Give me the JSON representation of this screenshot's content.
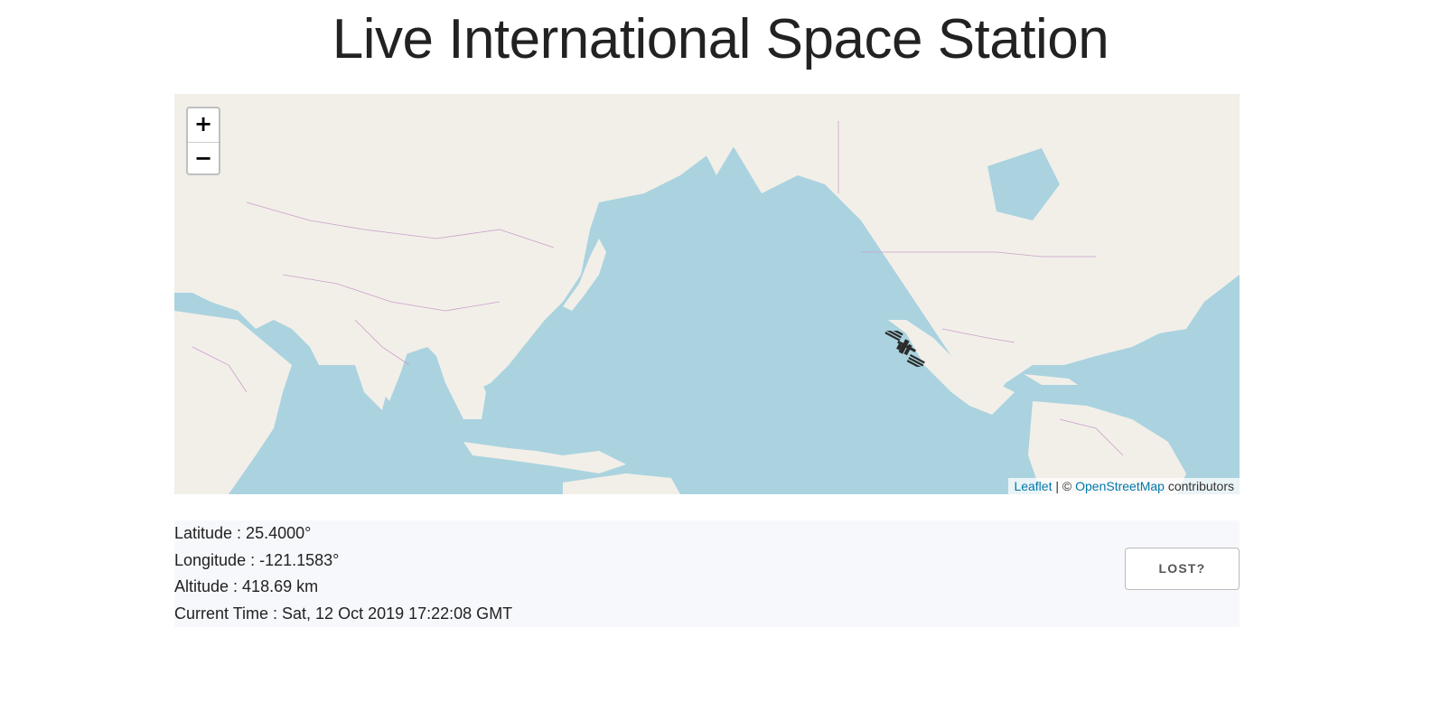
{
  "page": {
    "title": "Live International Space Station"
  },
  "map": {
    "zoom_in": "+",
    "zoom_out": "−",
    "attribution": {
      "leaflet": "Leaflet",
      "separator": " | © ",
      "osm": "OpenStreetMap",
      "suffix": " contributors"
    },
    "marker_icon": "iss-icon",
    "colors": {
      "water": "#aad3df",
      "land": "#f2efe9",
      "border": "#c9a0c9"
    }
  },
  "info": {
    "latitude": "Latitude : 25.4000°",
    "longitude": "Longitude : -121.1583°",
    "altitude": "Altitude : 418.69 km",
    "time": "Current Time : Sat, 12 Oct 2019 17:22:08 GMT"
  },
  "lost_button": "LOST?"
}
